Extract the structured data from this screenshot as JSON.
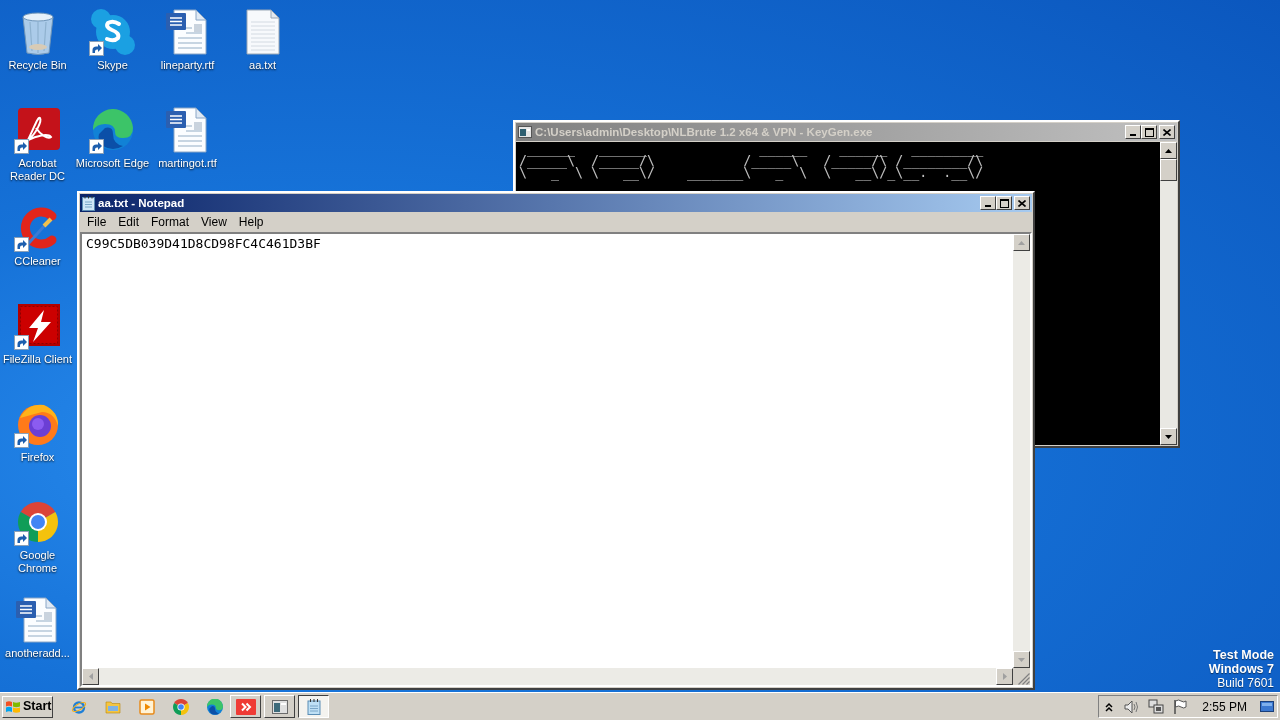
{
  "desktop": {
    "icon_columns": [
      [
        {
          "label": "Recycle Bin",
          "kind": "recycle-bin",
          "shortcut": false
        },
        {
          "label": "Acrobat Reader DC",
          "kind": "acrobat",
          "shortcut": true
        },
        {
          "label": "CCleaner",
          "kind": "ccleaner",
          "shortcut": true
        },
        {
          "label": "FileZilla Client",
          "kind": "filezilla",
          "shortcut": true
        },
        {
          "label": "Firefox",
          "kind": "firefox",
          "shortcut": true
        },
        {
          "label": "Google Chrome",
          "kind": "chrome",
          "shortcut": true
        },
        {
          "label": "anotheradd...",
          "kind": "word-doc",
          "shortcut": false
        }
      ],
      [
        {
          "label": "Skype",
          "kind": "skype",
          "shortcut": true
        },
        {
          "label": "Microsoft Edge",
          "kind": "edge",
          "shortcut": true
        }
      ],
      [
        {
          "label": "lineparty.rtf",
          "kind": "word-doc",
          "shortcut": false
        },
        {
          "label": "martingot.rtf",
          "kind": "word-doc",
          "shortcut": false
        }
      ],
      [
        {
          "label": "aa.txt",
          "kind": "text-doc",
          "shortcut": false
        }
      ]
    ],
    "system_notice": {
      "test_mode": "Test Mode",
      "edition": "Windows 7",
      "build": "Build 7601"
    }
  },
  "console_window": {
    "title": "C:\\Users\\admin\\Desktop\\NLBrute 1.2 x64 & VPN - KeyGen.exe",
    "active": false,
    "lines": [
      " ______   ______              ______    ______   _________",
      "/_____\\  /_____/\\           /_____\\   /_____/\\ /________/\\",
      "\\   _  \\ \\   __\\/    _______\\   _  \\  \\   __\\/_\\__.  .__\\/"
    ]
  },
  "notepad_window": {
    "title": "aa.txt - Notepad",
    "active": true,
    "menu": [
      "File",
      "Edit",
      "Format",
      "View",
      "Help"
    ],
    "text": "C99C5DB039D41D8CD98FC4C461D3BF"
  },
  "taskbar": {
    "start": "Start",
    "quick_launch": [
      {
        "kind": "internet-explorer"
      },
      {
        "kind": "folder"
      },
      {
        "kind": "media-player"
      },
      {
        "kind": "chrome"
      },
      {
        "kind": "edge"
      }
    ],
    "windows": [
      {
        "kind": "red-app",
        "selected": false
      },
      {
        "kind": "console",
        "selected": false
      },
      {
        "kind": "notepad",
        "selected": true
      }
    ],
    "clock": "2:55 PM"
  }
}
